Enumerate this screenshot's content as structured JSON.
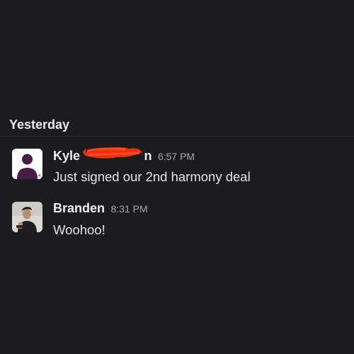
{
  "day_divider": {
    "label": "Yesterday"
  },
  "messages": [
    {
      "author_first": "Kyle",
      "author_last_end": "n",
      "author_last_redacted": true,
      "time": "6:57 PM",
      "text": "Just signed our 2nd harmony deal",
      "avatar": "default-person-icon"
    },
    {
      "author": "Branden",
      "time": "8:31 PM",
      "text": "Woohoo!",
      "avatar": "profile-photo"
    }
  ],
  "colors": {
    "background": "#1b1c1f",
    "default_avatar_fill": "#4a1d44",
    "redaction_scribble": "#e8310f"
  }
}
